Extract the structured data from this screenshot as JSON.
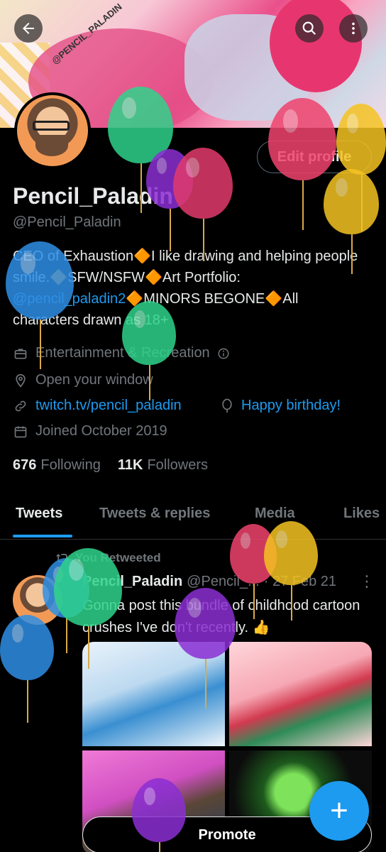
{
  "banner": {
    "tag": "@PENCIL_PALADIN"
  },
  "profile": {
    "display_name": "Pencil_Paladin",
    "handle": "@Pencil_Paladin",
    "edit_label": "Edit profile",
    "bio_part1": "CEO of Exhaustion🔶I like drawing and helping people smile.🔶SFW/NSFW🔶Art Portfolio: ",
    "bio_link": "@pencil_paladin2",
    "bio_part2": "🔶MINORS BEGONE🔶All characters drawn as 18+",
    "category": "Entertainment & Recreation",
    "location": "Open your window",
    "website": "twitch.tv/pencil_paladin",
    "birthday": "Happy birthday!",
    "joined": "Joined October 2019",
    "following_count": "676",
    "following_label": "Following",
    "followers_count": "11K",
    "followers_label": "Followers"
  },
  "tabs": [
    "Tweets",
    "Tweets & replies",
    "Media",
    "Likes"
  ],
  "tweet": {
    "retweet_label": "You Retweeted",
    "name": "Pencil_Paladin",
    "handle": "@Pencil_...",
    "date": "· 27 Feb 21",
    "text": "Gonna post this bundle of childhood cartoon crushes I've don't recently. 👍"
  },
  "promote_label": "Promote",
  "icons": {
    "back": "arrow-left-icon",
    "search": "search-icon",
    "more": "more-vertical-icon",
    "category": "briefcase-icon",
    "location": "location-pin-icon",
    "website": "link-icon",
    "birthday": "balloon-icon",
    "joined": "calendar-icon",
    "retweet": "retweet-icon",
    "compose": "plus-icon"
  },
  "colors": {
    "accent": "#1d9bf0",
    "muted": "#71767b",
    "background": "#000000"
  }
}
